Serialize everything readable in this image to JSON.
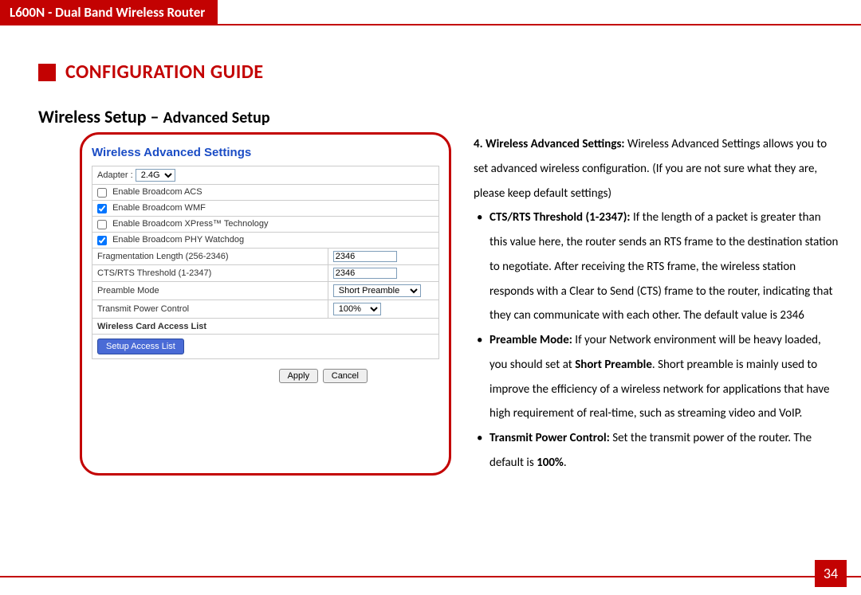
{
  "header": {
    "title": "L600N - Dual Band Wireless Router"
  },
  "section": {
    "heading": "CONFIGURATION GUIDE"
  },
  "subheading": {
    "main": "Wireless Setup",
    "sep": " – ",
    "sub": "Advanced Setup"
  },
  "panel": {
    "title": "Wireless Advanced Settings",
    "adapter_label": "Adapter :",
    "adapter_value": "2.4G",
    "cb1": {
      "label": "Enable Broadcom ACS",
      "checked": false
    },
    "cb2": {
      "label": "Enable Broadcom WMF",
      "checked": true
    },
    "cb3": {
      "label": "Enable Broadcom XPress™ Technology",
      "checked": false
    },
    "cb4": {
      "label": "Enable Broadcom PHY Watchdog",
      "checked": true
    },
    "frag": {
      "label": "Fragmentation Length (256-2346)",
      "value": "2346"
    },
    "cts": {
      "label": "CTS/RTS Threshold (1-2347)",
      "value": "2346"
    },
    "preamble": {
      "label": "Preamble Mode",
      "value": "Short Preamble"
    },
    "tx": {
      "label": "Transmit Power Control",
      "value": "100%"
    },
    "acl_heading": "Wireless Card Access List",
    "setup_btn": "Setup Access List",
    "apply": "Apply",
    "cancel": "Cancel"
  },
  "desc": {
    "intro_num": "4. ",
    "intro_bold": "Wireless Advanced Settings: ",
    "intro_rest": "Wireless Advanced Settings allows you to set advanced wireless configuration. (If you are not sure what they are, please keep default settings)",
    "b1_bold": "CTS/RTS Threshold (1-2347): ",
    "b1_rest": "If the length of a packet is greater than this value here, the router sends an RTS frame to the destination station to negotiate. After receiving the RTS frame, the wireless station responds with a Clear to Send (CTS) frame to the router, indicating that they can communicate with each other. The default value is 2346",
    "b2_bold": "Preamble Mode: ",
    "b2_mid1": "If your Network environment will be heavy loaded, you should set at ",
    "b2_sp": "Short Preamble",
    "b2_mid2": ". Short preamble is mainly used to improve the efficiency of a wireless network for applications that have high requirement of real-time, such as streaming video and VoIP.",
    "b3_bold": "Transmit Power Control: ",
    "b3_mid": "Set the transmit power of the router. The default is ",
    "b3_val": "100%",
    "b3_end": "."
  },
  "page": "34"
}
